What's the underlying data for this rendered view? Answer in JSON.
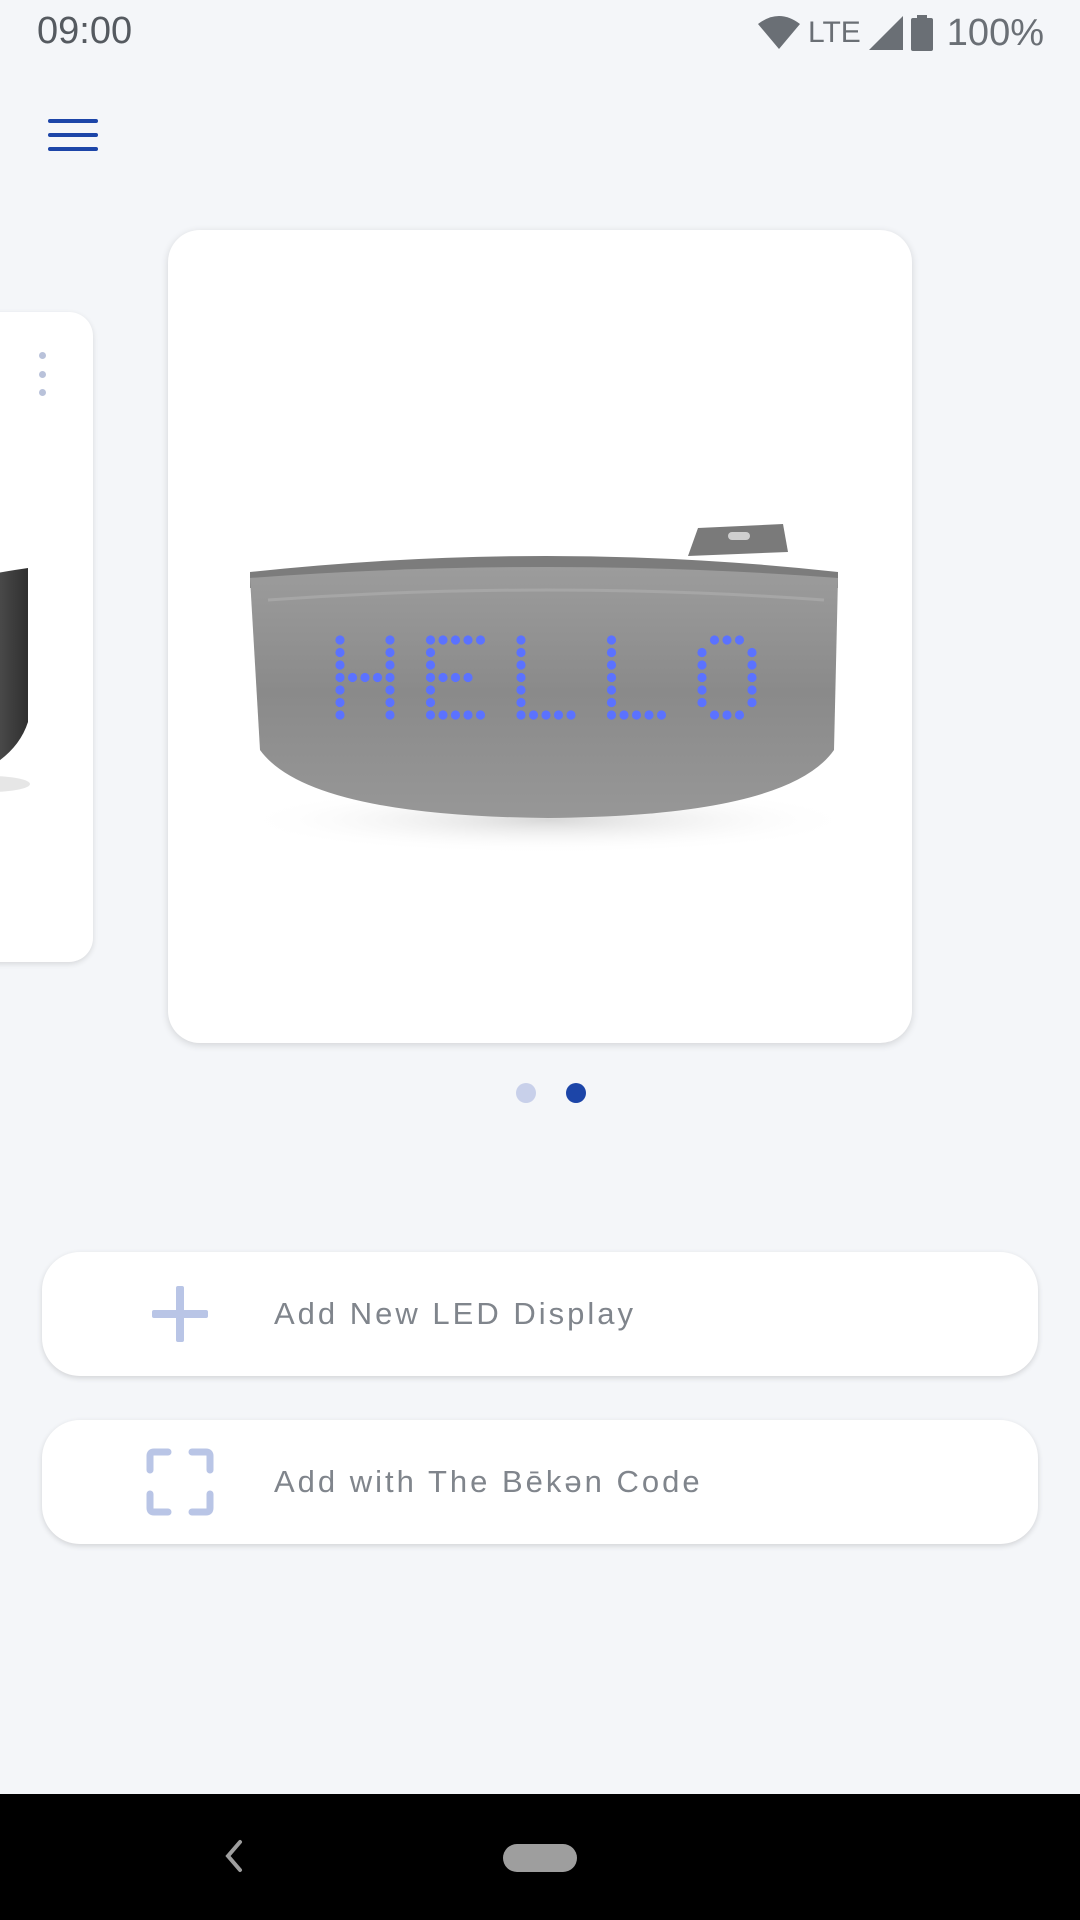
{
  "status_bar": {
    "time": "09:00",
    "network": "LTE",
    "battery": "100%"
  },
  "carousel": {
    "display_text": "HELLO",
    "page_count": 2,
    "active_page": 2
  },
  "actions": {
    "add_led": {
      "label": "Add New LED Display",
      "icon": "plus-icon"
    },
    "add_code": {
      "label": "Add with The Bēkən Code",
      "icon": "scan-frame-icon"
    }
  },
  "colors": {
    "accent": "#1c45a8",
    "accent_light": "#c8d0ea",
    "led": "#5b72ff",
    "background": "#f4f6f9"
  }
}
